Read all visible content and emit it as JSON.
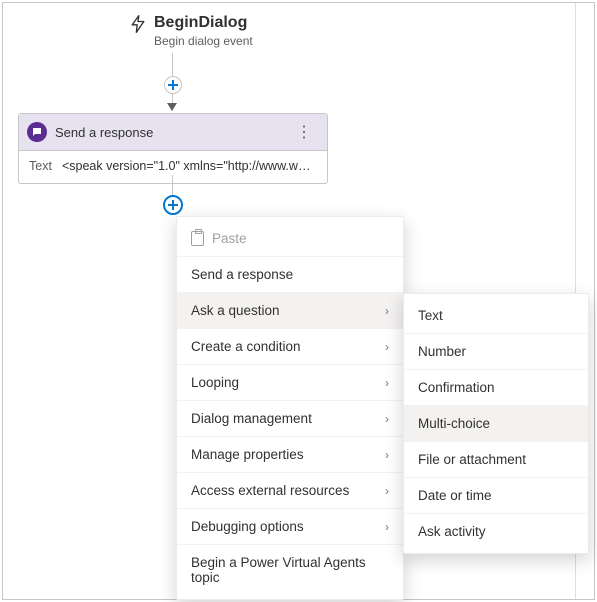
{
  "trigger": {
    "title": "BeginDialog",
    "subtitle": "Begin dialog event"
  },
  "node": {
    "title": "Send a response",
    "body_label": "Text",
    "body_value": "<speak version=\"1.0\" xmlns=\"http://www.w3...."
  },
  "menu": {
    "items": [
      {
        "label": "Paste",
        "disabled": true,
        "icon": "paste-icon",
        "submenu": false
      },
      {
        "label": "Send a response",
        "submenu": false
      },
      {
        "label": "Ask a question",
        "submenu": true,
        "highlight": true
      },
      {
        "label": "Create a condition",
        "submenu": true
      },
      {
        "label": "Looping",
        "submenu": true
      },
      {
        "label": "Dialog management",
        "submenu": true
      },
      {
        "label": "Manage properties",
        "submenu": true
      },
      {
        "label": "Access external resources",
        "submenu": true
      },
      {
        "label": "Debugging options",
        "submenu": true
      },
      {
        "label": "Begin a Power Virtual Agents topic",
        "submenu": false
      }
    ]
  },
  "submenu": {
    "items": [
      {
        "label": "Text"
      },
      {
        "label": "Number"
      },
      {
        "label": "Confirmation"
      },
      {
        "label": "Multi-choice",
        "highlight": true
      },
      {
        "label": "File or attachment"
      },
      {
        "label": "Date or time"
      },
      {
        "label": "Ask activity"
      }
    ]
  }
}
